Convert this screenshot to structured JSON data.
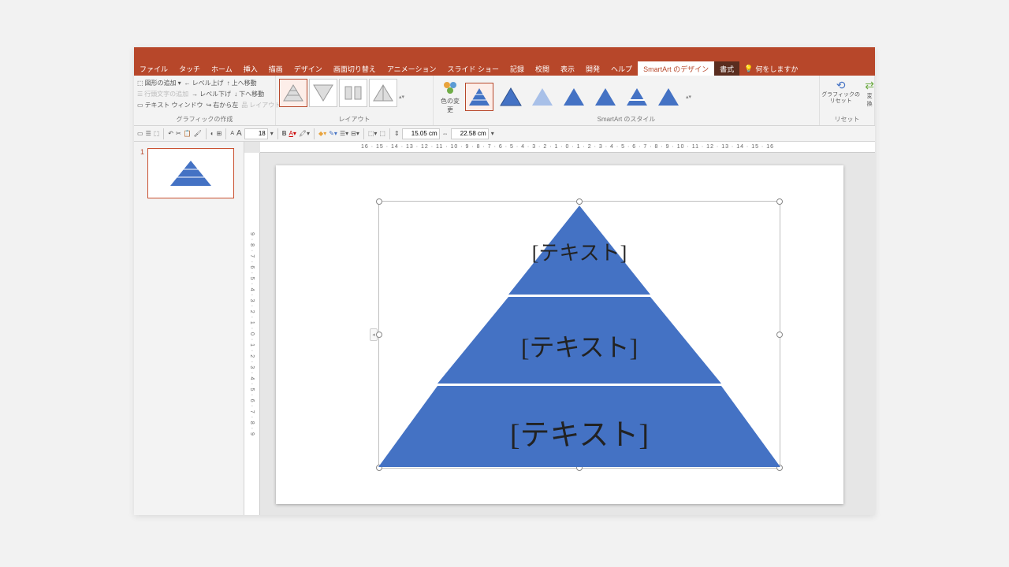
{
  "tabs": {
    "file": "ファイル",
    "touch": "タッチ",
    "home": "ホーム",
    "insert": "挿入",
    "draw": "描画",
    "design": "デザイン",
    "transitions": "画面切り替え",
    "animations": "アニメーション",
    "slideshow": "スライド ショー",
    "record": "記録",
    "review": "校閲",
    "view": "表示",
    "developer": "開発",
    "help": "ヘルプ",
    "smartart_design": "SmartArt のデザイン",
    "format": "書式",
    "tellme": "何をしますか"
  },
  "ribbon": {
    "g1": {
      "add_shape": "図形の追加",
      "level_up": "レベル上げ",
      "move_up": "上へ移動",
      "bullet": "行頭文字の追加",
      "level_down": "レベル下げ",
      "move_down": "下へ移動",
      "text_pane": "テキスト ウィンドウ",
      "rtl": "右から左",
      "layout": "レイアウト",
      "label": "グラフィックの作成"
    },
    "layout_label": "レイアウト",
    "color_change": "色の変更",
    "styles_label": "SmartArt のスタイル",
    "reset": "グラフィックのリセット",
    "convert": "変換",
    "reset_label": "リセット"
  },
  "qat": {
    "font_size": "18",
    "height": "15.05 cm",
    "width": "22.58 cm"
  },
  "ruler_h": "16 · 15 · 14 · 13 · 12 · 11 · 10 · 9 · 8 · 7 · 6 · 5 · 4 · 3 · 2 · 1 · 0 · 1 · 2 · 3 · 4 · 5 · 6 · 7 · 8 · 9 · 10 · 11 · 12 · 13 · 14 · 15 · 16",
  "ruler_v": "9 · 8 · 7 · 6 · 5 · 4 · 3 · 2 · 1 · 0 · 1 · 2 · 3 · 4 · 5 · 6 · 7 · 8 · 9",
  "thumb_num": "1",
  "pyramid": {
    "t1": "[テキスト]",
    "t2": "[テキスト]",
    "t3": "[テキスト]"
  },
  "colors": {
    "accent": "#4472c4",
    "ribbon": "#b7472a"
  }
}
